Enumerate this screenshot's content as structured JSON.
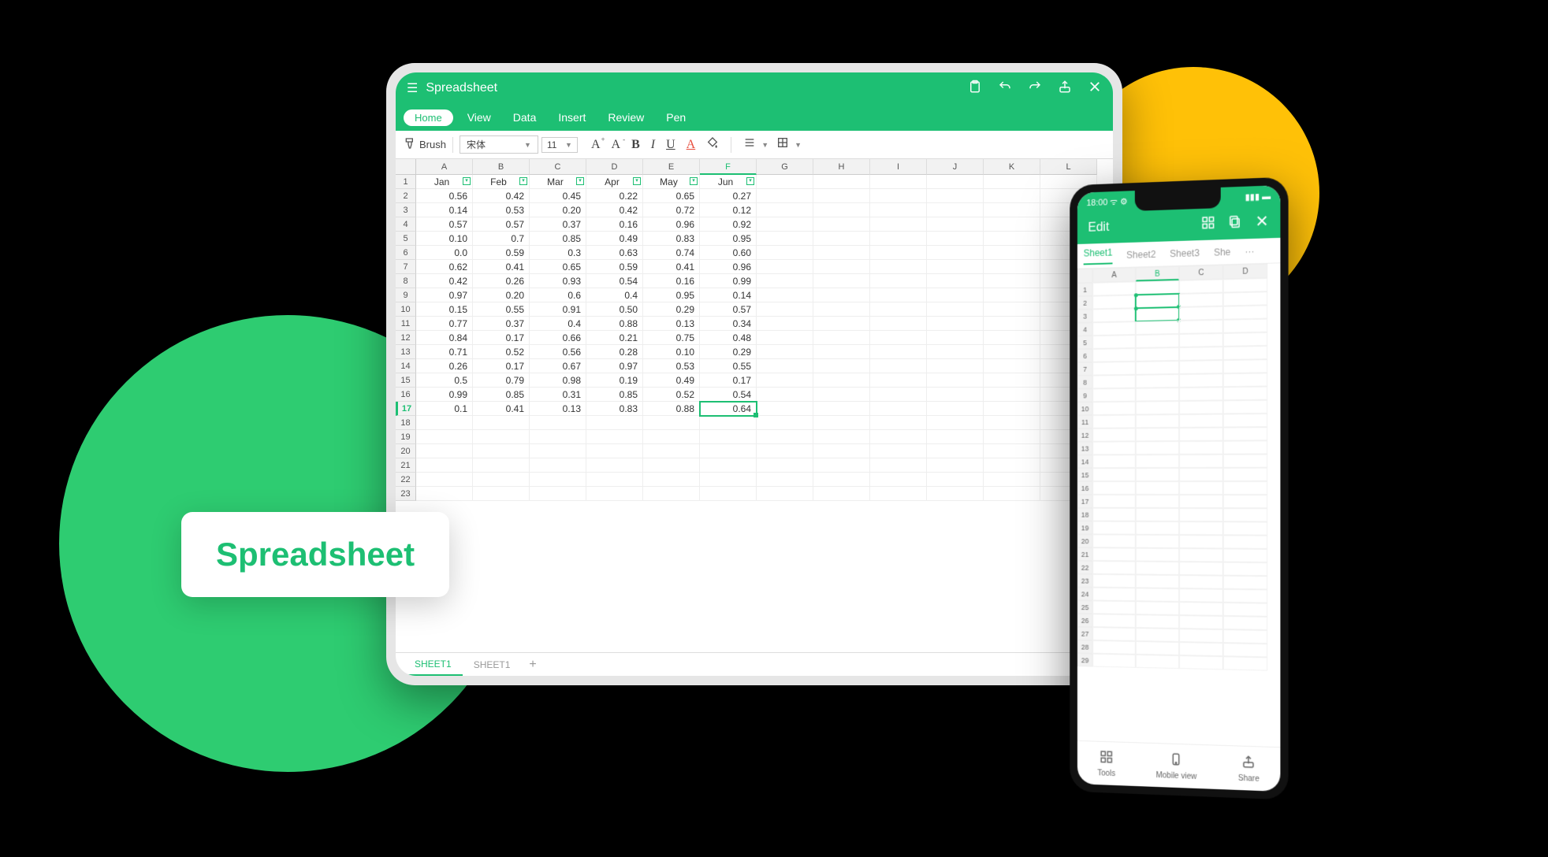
{
  "badge": {
    "label": "Spreadsheet"
  },
  "tablet": {
    "title": "Spreadsheet",
    "tabs": {
      "home": "Home",
      "view": "View",
      "data": "Data",
      "insert": "Insert",
      "review": "Review",
      "pen": "Pen"
    },
    "toolbar": {
      "brush": "Brush",
      "font": "宋体",
      "size": "11"
    },
    "columns": [
      "A",
      "B",
      "C",
      "D",
      "E",
      "F",
      "G",
      "H",
      "I",
      "J",
      "K",
      "L"
    ],
    "headers": [
      "Jan",
      "Feb",
      "Mar",
      "Apr",
      "May",
      "Jun"
    ],
    "rows": [
      [
        "0.56",
        "0.42",
        "0.45",
        "0.22",
        "0.65",
        "0.27"
      ],
      [
        "0.14",
        "0.53",
        "0.20",
        "0.42",
        "0.72",
        "0.12"
      ],
      [
        "0.57",
        "0.57",
        "0.37",
        "0.16",
        "0.96",
        "0.92"
      ],
      [
        "0.10",
        "0.7",
        "0.85",
        "0.49",
        "0.83",
        "0.95"
      ],
      [
        "0.0",
        "0.59",
        "0.3",
        "0.63",
        "0.74",
        "0.60"
      ],
      [
        "0.62",
        "0.41",
        "0.65",
        "0.59",
        "0.41",
        "0.96"
      ],
      [
        "0.42",
        "0.26",
        "0.93",
        "0.54",
        "0.16",
        "0.99"
      ],
      [
        "0.97",
        "0.20",
        "0.6",
        "0.4",
        "0.95",
        "0.14"
      ],
      [
        "0.15",
        "0.55",
        "0.91",
        "0.50",
        "0.29",
        "0.57"
      ],
      [
        "0.77",
        "0.37",
        "0.4",
        "0.88",
        "0.13",
        "0.34"
      ],
      [
        "0.84",
        "0.17",
        "0.66",
        "0.21",
        "0.75",
        "0.48"
      ],
      [
        "0.71",
        "0.52",
        "0.56",
        "0.28",
        "0.10",
        "0.29"
      ],
      [
        "0.26",
        "0.17",
        "0.67",
        "0.97",
        "0.53",
        "0.55"
      ],
      [
        "0.5",
        "0.79",
        "0.98",
        "0.19",
        "0.49",
        "0.17"
      ],
      [
        "0.99",
        "0.85",
        "0.31",
        "0.85",
        "0.52",
        "0.54"
      ],
      [
        "0.1",
        "0.41",
        "0.13",
        "0.83",
        "0.88",
        "0.64"
      ]
    ],
    "selected": {
      "row": 17,
      "col": 6
    },
    "sheets": {
      "s1": "SHEET1",
      "s2": "SHEET1"
    }
  },
  "phone": {
    "time": "18:00",
    "edit": "Edit",
    "tabs": {
      "t1": "Sheet1",
      "t2": "Sheet2",
      "t3": "Sheet3",
      "t4": "She",
      "more": "···"
    },
    "cols": [
      "A",
      "B",
      "C",
      "D"
    ],
    "bottom": {
      "tools": "Tools",
      "mobile": "Mobile view",
      "share": "Share"
    }
  }
}
